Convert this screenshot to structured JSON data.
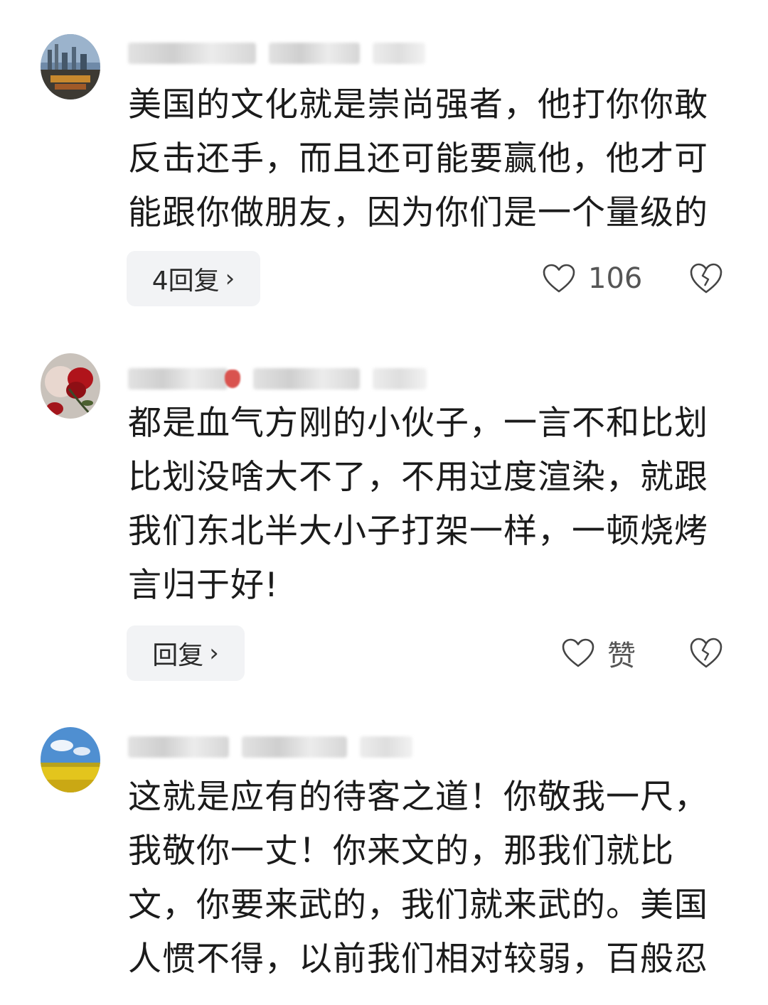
{
  "comments": [
    {
      "lines": [
        "美国的文化就是崇尚强者，他打你你敢",
        "反击还手，而且还可能要赢他，他才可",
        "能跟你做朋友，因为你们是一个量级的"
      ],
      "reply_label": "4回复",
      "like_count": "106"
    },
    {
      "lines": [
        "都是血气方刚的小伙子，一言不和比划",
        "比划没啥大不了，不用过度渲染，就跟",
        "我们东北半大小子打架一样，一顿烧烤",
        "言归于好!"
      ],
      "reply_label": "回复",
      "like_count": "赞"
    },
    {
      "lines": [
        "这就是应有的待客之道！你敬我一尺，",
        "我敬你一丈！你来文的，那我们就比",
        "文，你要来武的，我们就来武的。美国",
        "人惯不得，以前我们相对较弱，百般忍"
      ],
      "reply_label": "",
      "like_count": ""
    }
  ],
  "chevron": "›",
  "icons": [
    "heart-outline-icon",
    "broken-heart-icon",
    "chevron-right-icon"
  ],
  "colors": {
    "reply_bg": "#f2f3f5",
    "text": "#1b1b1b",
    "meta": "#555555"
  }
}
